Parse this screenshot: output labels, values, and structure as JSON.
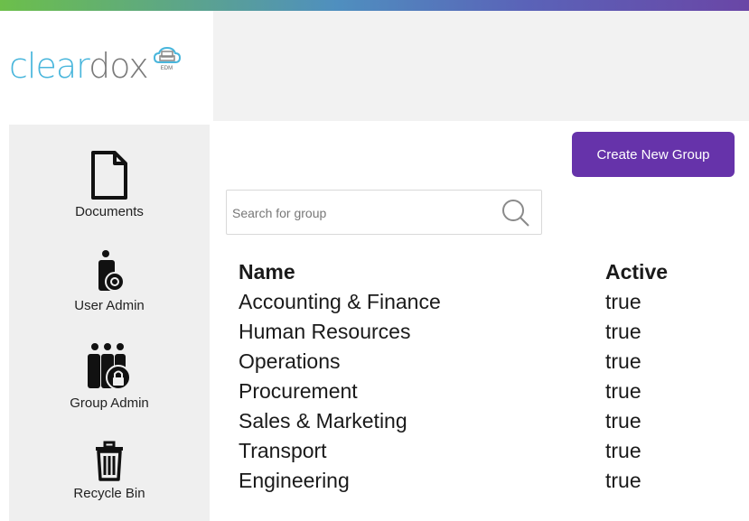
{
  "brand": {
    "logo_part1": "clear",
    "logo_part2": "dox",
    "logo_sub": "EDM"
  },
  "sidebar": {
    "items": [
      {
        "label": "Documents",
        "icon": "document-icon"
      },
      {
        "label": "User Admin",
        "icon": "user-admin-icon"
      },
      {
        "label": "Group Admin",
        "icon": "group-admin-icon"
      },
      {
        "label": "Recycle Bin",
        "icon": "trash-icon"
      }
    ]
  },
  "toolbar": {
    "create_label": "Create New Group"
  },
  "search": {
    "placeholder": "Search for group",
    "value": ""
  },
  "table": {
    "headers": {
      "name": "Name",
      "active": "Active"
    },
    "rows": [
      {
        "name": "Accounting & Finance",
        "active": "true"
      },
      {
        "name": "Human Resources",
        "active": "true"
      },
      {
        "name": "Operations",
        "active": "true"
      },
      {
        "name": "Procurement",
        "active": "true"
      },
      {
        "name": "Sales & Marketing",
        "active": "true"
      },
      {
        "name": "Transport",
        "active": "true"
      },
      {
        "name": "Engineering",
        "active": "true"
      }
    ]
  },
  "colors": {
    "accent": "#6633aa",
    "logo_blue": "#49b6dc",
    "logo_gray": "#7a7a7a"
  }
}
